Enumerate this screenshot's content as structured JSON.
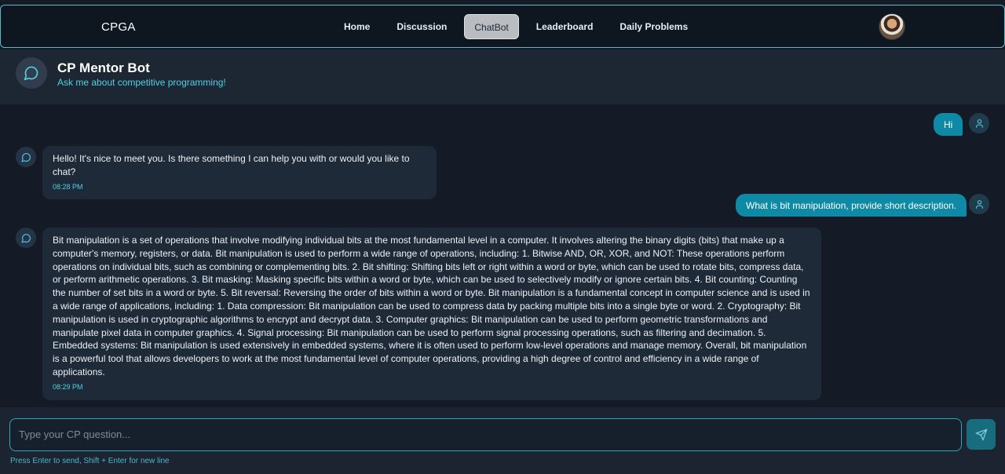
{
  "navbar": {
    "brand": "CPGA",
    "links": [
      "Home",
      "Discussion",
      "ChatBot",
      "Leaderboard",
      "Daily Problems"
    ],
    "active": "ChatBot"
  },
  "bot_header": {
    "title": "CP Mentor Bot",
    "subtitle": "Ask me about competitive programming!"
  },
  "messages": [
    {
      "role": "user",
      "text": "Hi"
    },
    {
      "role": "bot",
      "text": "Hello! It's nice to meet you. Is there something I can help you with or would you like to chat?",
      "time": "08:28 PM"
    },
    {
      "role": "user",
      "text": "What is bit manipulation, provide short description."
    },
    {
      "role": "bot",
      "text": "Bit manipulation is a set of operations that involve modifying individual bits at the most fundamental level in a computer. It involves altering the binary digits (bits) that make up a computer's memory, registers, or data. Bit manipulation is used to perform a wide range of operations, including: 1. Bitwise AND, OR, XOR, and NOT: These operations perform operations on individual bits, such as combining or complementing bits. 2. Bit shifting: Shifting bits left or right within a word or byte, which can be used to rotate bits, compress data, or perform arithmetic operations. 3. Bit masking: Masking specific bits within a word or byte, which can be used to selectively modify or ignore certain bits. 4. Bit counting: Counting the number of set bits in a word or byte. 5. Bit reversal: Reversing the order of bits within a word or byte. Bit manipulation is a fundamental concept in computer science and is used in a wide range of applications, including: 1. Data compression: Bit manipulation can be used to compress data by packing multiple bits into a single byte or word. 2. Cryptography: Bit manipulation is used in cryptographic algorithms to encrypt and decrypt data. 3. Computer graphics: Bit manipulation can be used to perform geometric transformations and manipulate pixel data in computer graphics. 4. Signal processing: Bit manipulation can be used to perform signal processing operations, such as filtering and decimation. 5. Embedded systems: Bit manipulation is used extensively in embedded systems, where it is often used to perform low-level operations and manage memory. Overall, bit manipulation is a powerful tool that allows developers to work at the most fundamental level of computer operations, providing a high degree of control and efficiency in a wide range of applications.",
      "time": "08:29 PM"
    }
  ],
  "input": {
    "placeholder": "Type your CP question...",
    "value": "",
    "hint": "Press Enter to send, Shift + Enter for new line"
  },
  "icons": {
    "bot": "message-circle-icon",
    "user": "user-icon",
    "send": "send-icon",
    "profile": "profile-avatar"
  },
  "colors": {
    "accent": "#0e8aa6",
    "accent_text": "#4fd1e6",
    "background": "#141b27"
  }
}
